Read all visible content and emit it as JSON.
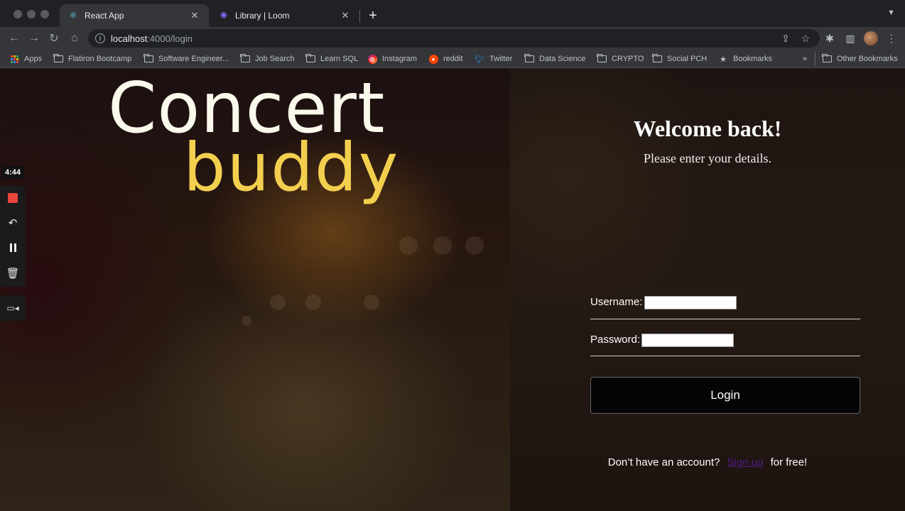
{
  "browser": {
    "tabs": [
      {
        "title": "React App",
        "icon": "react-icon",
        "active": true
      },
      {
        "title": "Library | Loom",
        "icon": "loom-icon",
        "active": false
      }
    ],
    "address": {
      "host": "localhost",
      "path": ":4000/login"
    },
    "bookmarks": [
      {
        "label": "Apps",
        "icon": "apps-grid-icon"
      },
      {
        "label": "Flatiron Bootcamp",
        "icon": "folder-icon"
      },
      {
        "label": "Software Engineer...",
        "icon": "folder-icon"
      },
      {
        "label": "Job Search",
        "icon": "folder-icon"
      },
      {
        "label": "Learn SQL",
        "icon": "folder-icon"
      },
      {
        "label": "Instagram",
        "icon": "instagram-icon"
      },
      {
        "label": "reddit",
        "icon": "reddit-icon"
      },
      {
        "label": "Twitter",
        "icon": "twitter-icon"
      },
      {
        "label": "Data Science",
        "icon": "folder-icon"
      },
      {
        "label": "CRYPTO",
        "icon": "folder-icon"
      },
      {
        "label": "Social PCH",
        "icon": "folder-icon"
      },
      {
        "label": "Bookmarks",
        "icon": "star-icon"
      },
      {
        "label": "Other Bookmarks",
        "icon": "folder-icon"
      }
    ],
    "overflow_label": "»"
  },
  "logo": {
    "line1": "Concert",
    "line2": "buddy"
  },
  "login": {
    "title": "Welcome back!",
    "subtitle": "Please enter your details.",
    "username_label": "Username:",
    "username_value": "",
    "password_label": "Password:",
    "password_value": "",
    "button_label": "Login",
    "signup_prefix": "Don’t have an account?",
    "signup_link": "Sign up",
    "signup_suffix": "for free!"
  },
  "loom": {
    "timer": "4:44"
  },
  "colors": {
    "logo_primary": "#fbf8ec",
    "logo_accent": "#f3cf4f",
    "button_bg": "#050505",
    "link": "#551a8b",
    "record_stop": "#e8453c"
  }
}
